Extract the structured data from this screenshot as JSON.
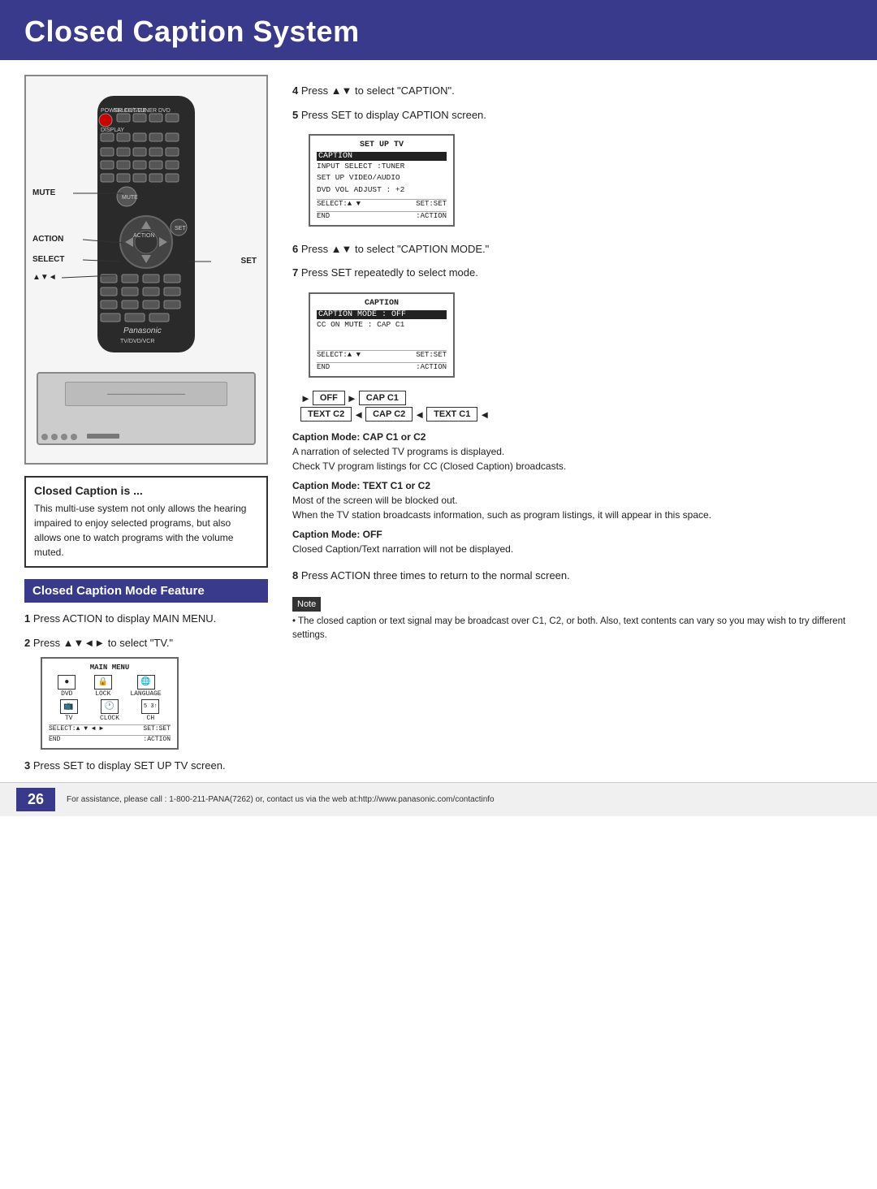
{
  "header": {
    "title": "Closed Caption System",
    "bg_color": "#3a3a8c"
  },
  "page_number": "26",
  "footer_text": "For assistance, please call : 1-800-211-PANA(7262) or, contact us via the web at:http://www.panasonic.com/contactinfo",
  "left": {
    "info_box_title": "Closed Caption is ...",
    "info_box_text": "This multi-use system not only allows the hearing impaired to enjoy selected programs, but also allows one to watch programs with the volume muted.",
    "mode_feature_title": "Closed Caption Mode Feature",
    "step1": "Press ACTION to display MAIN MENU.",
    "step2": "Press ▲▼◄► to select \"TV.\"",
    "step3": "Press SET to display SET UP TV screen.",
    "remote_labels": {
      "mute": "MUTE",
      "action": "ACTION",
      "select": "SELECT",
      "arrows": "▲▼◄",
      "set": "SET"
    }
  },
  "right": {
    "step4": "Press ▲▼ to select \"CAPTION\".",
    "step5": "Press SET to display CAPTION screen.",
    "step6": "Press ▲▼ to select \"CAPTION MODE.\"",
    "step7": "Press SET repeatedly to select mode.",
    "step8": "Press ACTION three times to return to the normal screen.",
    "setup_tv_screen": {
      "title": "SET UP TV",
      "highlighted": "CAPTION",
      "lines": [
        "INPUT SELECT   :TUNER",
        "SET UP VIDEO/AUDIO",
        "DVD VOL ADJUST : +2"
      ],
      "bottom_left": "SELECT:▲ ▼",
      "bottom_right": "SET:SET",
      "bottom2_left": "END",
      "bottom2_right": ":ACTION"
    },
    "caption_screen": {
      "title": "CAPTION",
      "highlighted": "CAPTION MODE : OFF",
      "lines": [
        "CC ON MUTE   : CAP C1"
      ],
      "bottom_left": "SELECT:▲ ▼",
      "bottom_right": "SET:SET",
      "bottom2_left": "END",
      "bottom2_right": ":ACTION"
    },
    "mode_diagram": {
      "row1": [
        "OFF",
        "CAP C1"
      ],
      "row2": [
        "TEXT C2",
        "CAP C2",
        "TEXT C1"
      ]
    },
    "caption_modes": {
      "cap_c1_c2_title": "Caption Mode: CAP C1 or C2",
      "cap_c1_c2_text": "A narration of selected TV programs is displayed.\nCheck TV program listings for CC (Closed Caption) broadcasts.",
      "text_c1_c2_title": "Caption Mode: TEXT C1 or C2",
      "text_c1_c2_text": "Most of the screen will be blocked out.\nWhen the TV station broadcasts information, such as program listings, it will appear in this space.",
      "off_title": "Caption Mode: OFF",
      "off_text": "Closed Caption/Text narration will not be displayed."
    },
    "note_text": "• The closed caption or text signal may be broadcast over C1, C2, or both. Also, text contents can vary so you may wish to try different settings."
  },
  "main_menu_screen": {
    "title": "MAIN MENU",
    "icons": [
      {
        "label": "DVD",
        "symbol": "⏺"
      },
      {
        "label": "LOCK",
        "symbol": "🔒"
      },
      {
        "label": "LANGUAGE",
        "symbol": "🌐"
      }
    ],
    "icons2": [
      {
        "label": "TV",
        "symbol": "📺"
      },
      {
        "label": "CLOCK",
        "symbol": "🕐"
      },
      {
        "label": "CH",
        "symbol": "53"
      }
    ],
    "bottom_left": "SELECT:▲ ▼ ◄ ►",
    "bottom_right": "SET:SET",
    "bottom2_left": "END",
    "bottom2_right": ":ACTION"
  }
}
